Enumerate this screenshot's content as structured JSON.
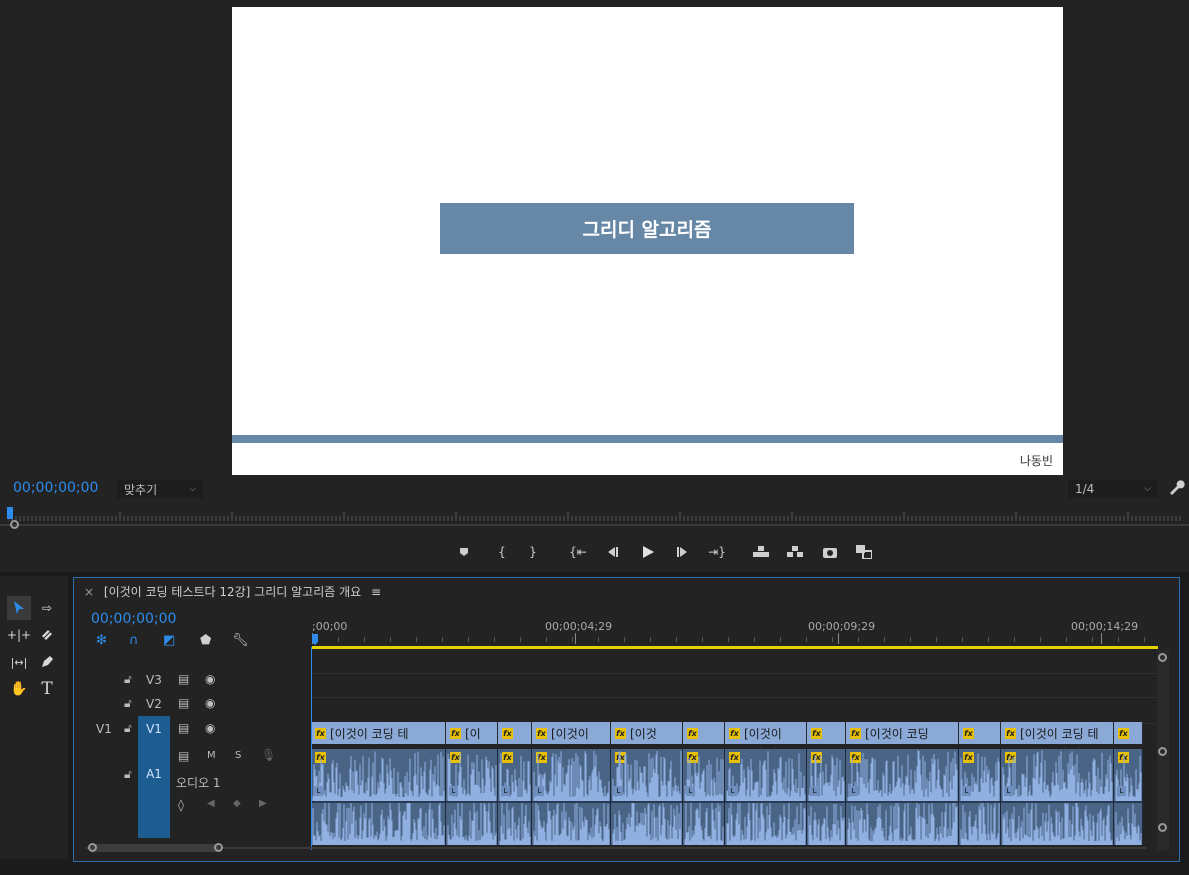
{
  "monitor": {
    "slide_title": "그리디 알고리즘",
    "slide_author": "나동빈",
    "timecode": "00;00;00;00",
    "fit_label": "맞추기",
    "quality_label": "1/4",
    "colors": {
      "slide_accent": "#6688a6",
      "timecode": "#2d8ceb",
      "clip_video": "#8aa9d6",
      "clip_audio": "#4a6486",
      "work_area": "#e5d300"
    }
  },
  "transport_icons": [
    "add-marker-icon",
    "mark-in-icon",
    "mark-out-icon",
    "go-to-in-icon",
    "step-back-icon",
    "play-icon",
    "step-forward-icon",
    "go-to-out-icon",
    "lift-icon",
    "extract-icon",
    "export-frame-icon",
    "compare-icon"
  ],
  "tools": [
    "selection-tool-icon",
    "track-select-tool-icon",
    "ripple-edit-tool-icon",
    "razor-tool-icon",
    "slip-tool-icon",
    "pen-tool-icon",
    "hand-tool-icon",
    "type-tool-icon"
  ],
  "timeline": {
    "sequence_name": "[이것이 코딩 테스트다 12강] 그리디 알고리즘 개요",
    "close_glyph": "×",
    "menu_glyph": "≡",
    "timecode": "00;00;00;00",
    "ruler_labels": [
      ";00;00",
      "00;00;04;29",
      "00;00;09;29",
      "00;00;14;29"
    ],
    "tracks": {
      "v3": "V3",
      "v2": "V2",
      "v1_source": "V1",
      "v1": "V1",
      "a1": "A1",
      "a1_name": "오디오 1",
      "mute": "M",
      "solo": "S"
    },
    "video_clips": [
      {
        "label": "[이것이 코딩 테"
      },
      {
        "label": "[이"
      },
      {
        "label": ""
      },
      {
        "label": "[이것이"
      },
      {
        "label": "[이것"
      },
      {
        "label": ""
      },
      {
        "label": "[이것이"
      },
      {
        "label": ""
      },
      {
        "label": "[이것이 코딩"
      },
      {
        "label": ""
      },
      {
        "label": "[이것이 코딩 테"
      },
      {
        "label": ""
      }
    ],
    "fx_label": "fx",
    "audio_marker": "L"
  }
}
